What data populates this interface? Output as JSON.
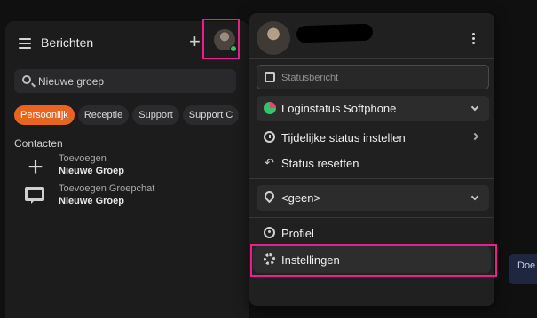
{
  "panel": {
    "title": "Berichten",
    "search_placeholder": "Nieuwe groep",
    "chips": [
      "Persoonlijk",
      "Receptie",
      "Support",
      "Support C"
    ],
    "section_label": "Contacten",
    "contacts": [
      {
        "line1": "Toevoegen",
        "line2": "Nieuwe Groep"
      },
      {
        "line1": "Toevoegen Groepchat",
        "line2": "Nieuwe Groep"
      }
    ]
  },
  "menu": {
    "status_placeholder": "Statusbericht",
    "login_status": "Loginstatus Softphone",
    "temp_status": "Tijdelijke status instellen",
    "reset_status": "Status resetten",
    "location": "<geen>",
    "profile": "Profiel",
    "settings": "Instellingen"
  },
  "right": {
    "bubble_text": "Doe"
  },
  "colors": {
    "accent_orange": "#e8651f",
    "highlight_pink": "#e8208f",
    "online_green": "#3dbd6a"
  }
}
